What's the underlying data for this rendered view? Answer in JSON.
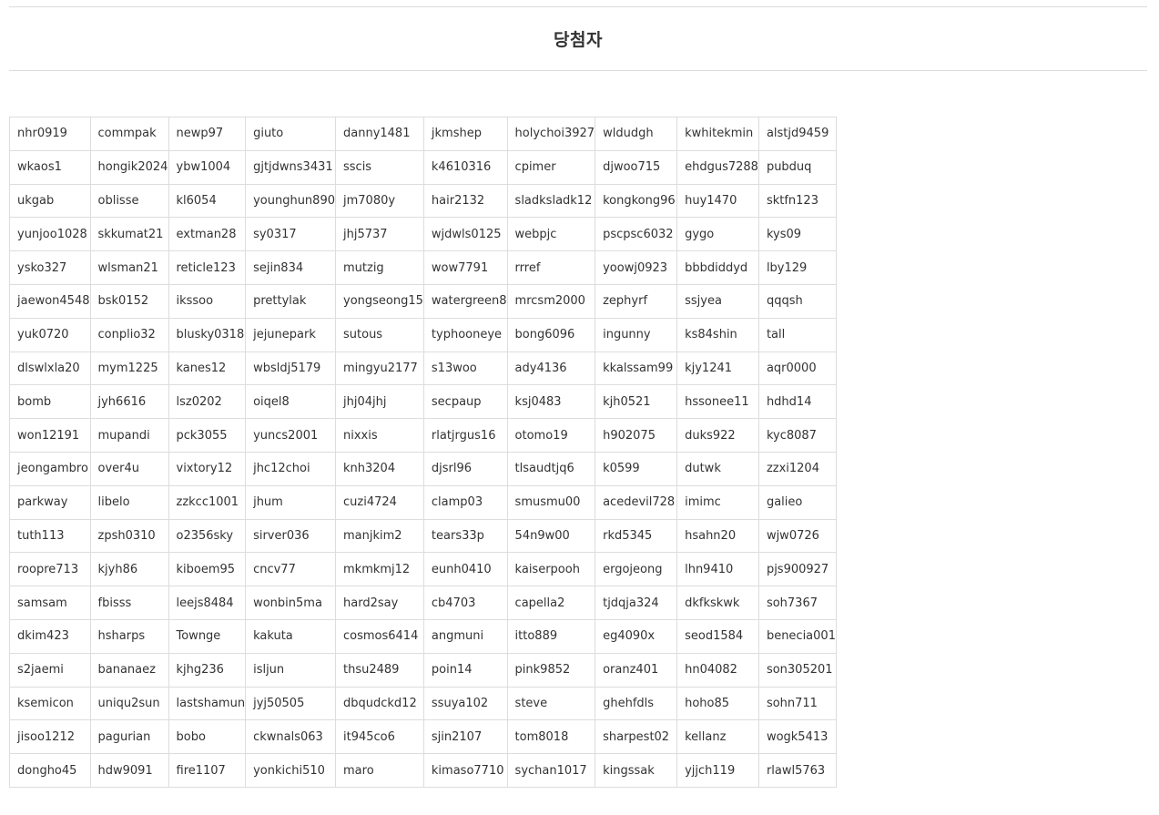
{
  "header": {
    "title": "당첨자"
  },
  "winners": [
    [
      "nhr0919",
      "commpak",
      "newp97",
      "giuto",
      "danny1481",
      "jkmshep",
      "holychoi3927",
      "wldudgh",
      "kwhitekmin",
      "alstjd9459"
    ],
    [
      "wkaos1",
      "hongik2024",
      "ybw1004",
      "gjtjdwns3431",
      "sscis",
      "k4610316",
      "cpimer",
      "djwoo715",
      "ehdgus7288",
      "pubduq"
    ],
    [
      "ukgab",
      "oblisse",
      "kl6054",
      "younghun890",
      "jm7080y",
      "hair2132",
      "sladksladk12",
      "kongkong96",
      "huy1470",
      "sktfn123"
    ],
    [
      "yunjoo1028",
      "skkumat21",
      "extman28",
      "sy0317",
      "jhj5737",
      "wjdwls0125",
      "webpjc",
      "pscpsc6032",
      "gygo",
      "kys09"
    ],
    [
      "ysko327",
      "wlsman21",
      "reticle123",
      "sejin834",
      "mutzig",
      "wow7791",
      "rrref",
      "yoowj0923",
      "bbbdiddyd",
      "lby129"
    ],
    [
      "jaewon4548",
      "bsk0152",
      "ikssoo",
      "prettylak",
      "yongseong15",
      "watergreen8",
      "mrcsm2000",
      "zephyrf",
      "ssjyea",
      "qqqsh"
    ],
    [
      "yuk0720",
      "conplio32",
      "blusky0318",
      "jejunepark",
      "sutous",
      "typhooneye",
      "bong6096",
      "ingunny",
      "ks84shin",
      "tall"
    ],
    [
      "dlswlxla20",
      "mym1225",
      "kanes12",
      "wbsldj5179",
      "mingyu2177",
      "s13woo",
      "ady4136",
      "kkalssam99",
      "kjy1241",
      "aqr0000"
    ],
    [
      "bomb",
      "jyh6616",
      "lsz0202",
      "oiqel8",
      "jhj04jhj",
      "secpaup",
      "ksj0483",
      "kjh0521",
      "hssonee11",
      "hdhd14"
    ],
    [
      "won12191",
      "mupandi",
      "pck3055",
      "yuncs2001",
      "nixxis",
      "rlatjrgus16",
      "otomo19",
      "h902075",
      "duks922",
      "kyc8087"
    ],
    [
      "jeongambro",
      "over4u",
      "vixtory12",
      "jhc12choi",
      "knh3204",
      "djsrl96",
      "tlsaudtjq6",
      "k0599",
      "dutwk",
      "zzxi1204"
    ],
    [
      "parkway",
      "libelo",
      "zzkcc1001",
      "jhum",
      "cuzi4724",
      "clamp03",
      "smusmu00",
      "acedevil728",
      "imimc",
      "galieo"
    ],
    [
      "tuth113",
      "zpsh0310",
      "o2356sky",
      "sirver036",
      "manjkim2",
      "tears33p",
      "54n9w00",
      "rkd5345",
      "hsahn20",
      "wjw0726"
    ],
    [
      "roopre713",
      "kjyh86",
      "kiboem95",
      "cncv77",
      "mkmkmj12",
      "eunh0410",
      "kaiserpooh",
      "ergojeong",
      "lhn9410",
      "pjs900927"
    ],
    [
      "samsam",
      "fbisss",
      "leejs8484",
      "wonbin5ma",
      "hard2say",
      "cb4703",
      "capella2",
      "tjdqja324",
      "dkfkskwk",
      "soh7367"
    ],
    [
      "dkim423",
      "hsharps",
      "Townge",
      "kakuta",
      "cosmos6414",
      "angmuni",
      "itto889",
      "eg4090x",
      "seod1584",
      "benecia001"
    ],
    [
      "s2jaemi",
      "bananaez",
      "kjhg236",
      "isljun",
      "thsu2489",
      "poin14",
      "pink9852",
      "oranz401",
      "hn04082",
      "son305201"
    ],
    [
      "ksemicon",
      "uniqu2sun",
      "lastshamun",
      "jyj50505",
      "dbqudckd12",
      "ssuya102",
      "steve",
      "ghehfdls",
      "hoho85",
      "sohn711"
    ],
    [
      "jisoo1212",
      "pagurian",
      "bobo",
      "ckwnals063",
      "it945co6",
      "sjin2107",
      "tom8018",
      "sharpest02",
      "kellanz",
      "wogk5413"
    ],
    [
      "dongho45",
      "hdw9091",
      "fire1107",
      "yonkichi510",
      "maro",
      "kimaso7710",
      "sychan1017",
      "kingssak",
      "yjjch119",
      "rlawl5763"
    ]
  ]
}
